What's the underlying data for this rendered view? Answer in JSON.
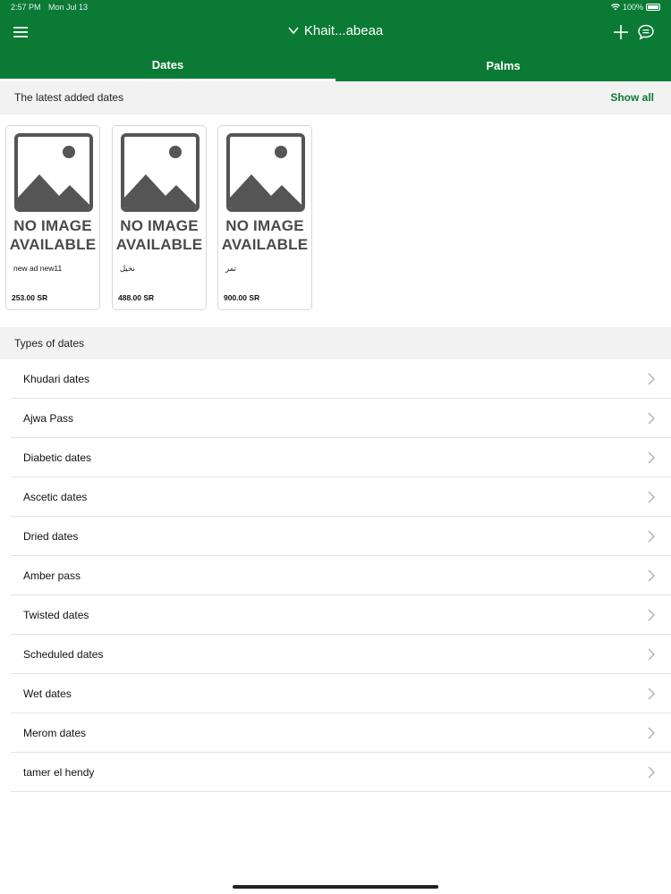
{
  "status_bar": {
    "time": "2:57 PM",
    "date": "Mon Jul 13",
    "battery": "100%"
  },
  "header": {
    "title": "Khait...abeaa"
  },
  "tabs": [
    {
      "label": "Dates"
    },
    {
      "label": "Palms"
    }
  ],
  "latest_section": {
    "title": "The latest added dates",
    "show_all": "Show all"
  },
  "cards": [
    {
      "placeholder_line1": "NO IMAGE",
      "placeholder_line2": "AVAILABLE",
      "name": "new ad new11",
      "price": "253.00 SR"
    },
    {
      "placeholder_line1": "NO IMAGE",
      "placeholder_line2": "AVAILABLE",
      "name": "نخيل",
      "price": "488.00 SR"
    },
    {
      "placeholder_line1": "NO IMAGE",
      "placeholder_line2": "AVAILABLE",
      "name": "تمر",
      "price": "900.00 SR"
    }
  ],
  "types_section": {
    "title": "Types of dates"
  },
  "types": [
    {
      "label": "Khudari dates"
    },
    {
      "label": "Ajwa Pass"
    },
    {
      "label": "Diabetic dates"
    },
    {
      "label": "Ascetic dates"
    },
    {
      "label": "Dried dates"
    },
    {
      "label": "Amber pass"
    },
    {
      "label": "Twisted dates"
    },
    {
      "label": "Scheduled dates"
    },
    {
      "label": "Wet dates"
    },
    {
      "label": "Merom dates"
    },
    {
      "label": "tamer el hendy"
    }
  ],
  "colors": {
    "brand_green": "#0a7a35",
    "section_bg": "#f2f2f2"
  },
  "icons": [
    "menu-icon",
    "chevron-down-icon",
    "plus-icon",
    "chat-icon",
    "wifi-icon",
    "battery-icon",
    "image-placeholder-icon",
    "chevron-right-icon"
  ]
}
